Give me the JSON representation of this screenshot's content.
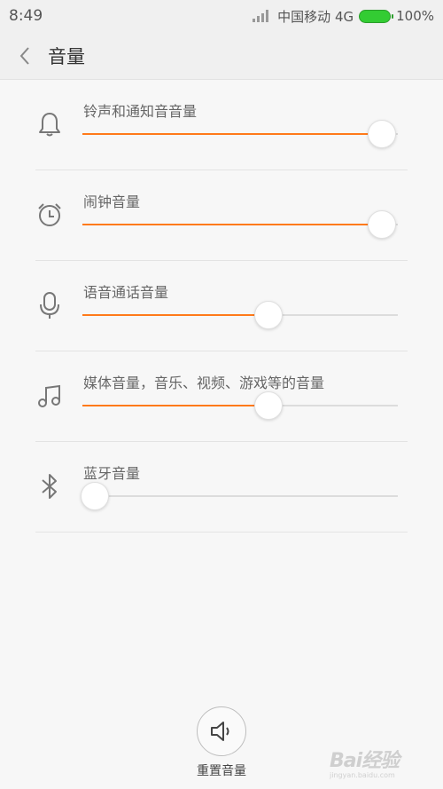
{
  "status_bar": {
    "time": "8:49",
    "carrier": "中国移动 4G",
    "battery": "100%",
    "battery_color": "#33cc33"
  },
  "header": {
    "title": "音量"
  },
  "accent_color": "#ff7a1a",
  "rows": [
    {
      "label": "铃声和通知音音量",
      "icon": "bell-icon",
      "level": 0.95
    },
    {
      "label": "闹钟音量",
      "icon": "alarm-clock-icon",
      "level": 0.95
    },
    {
      "label": "语音通话音量",
      "icon": "microphone-icon",
      "level": 0.59
    },
    {
      "label": "媒体音量，音乐、视频、游戏等的音量",
      "icon": "music-note-icon",
      "level": 0.59
    },
    {
      "label": "蓝牙音量",
      "icon": "bluetooth-icon",
      "level": 0.04
    }
  ],
  "reset": {
    "label": "重置音量",
    "icon": "speaker-icon"
  },
  "watermark": {
    "text": "Bai经验",
    "subtext": "jingyan.baidu.com"
  }
}
